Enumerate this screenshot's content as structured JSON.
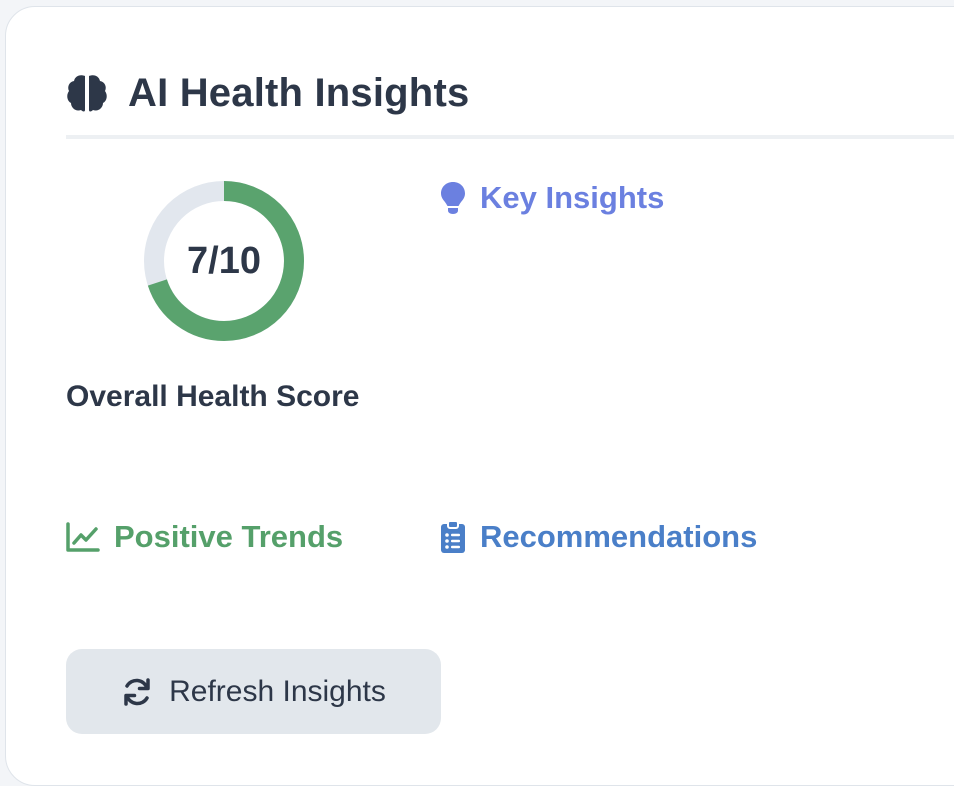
{
  "card": {
    "title": "AI Health Insights",
    "title_icon": "brain-icon"
  },
  "score": {
    "value_text": "7/10",
    "value": 7,
    "max": 10,
    "label": "Overall Health Score",
    "ring_color": "#5aa36e",
    "track_color": "#e2e7ee"
  },
  "sections": {
    "key_insights": {
      "label": "Key Insights",
      "icon": "lightbulb-icon",
      "color": "#6b80e0"
    },
    "positive_trends": {
      "label": "Positive Trends",
      "icon": "chart-line-icon",
      "color": "#55a06a"
    },
    "recommendations": {
      "label": "Recommendations",
      "icon": "clipboard-list-icon",
      "color": "#4a7fc8"
    }
  },
  "actions": {
    "refresh_label": "Refresh Insights",
    "refresh_icon": "refresh-icon"
  }
}
